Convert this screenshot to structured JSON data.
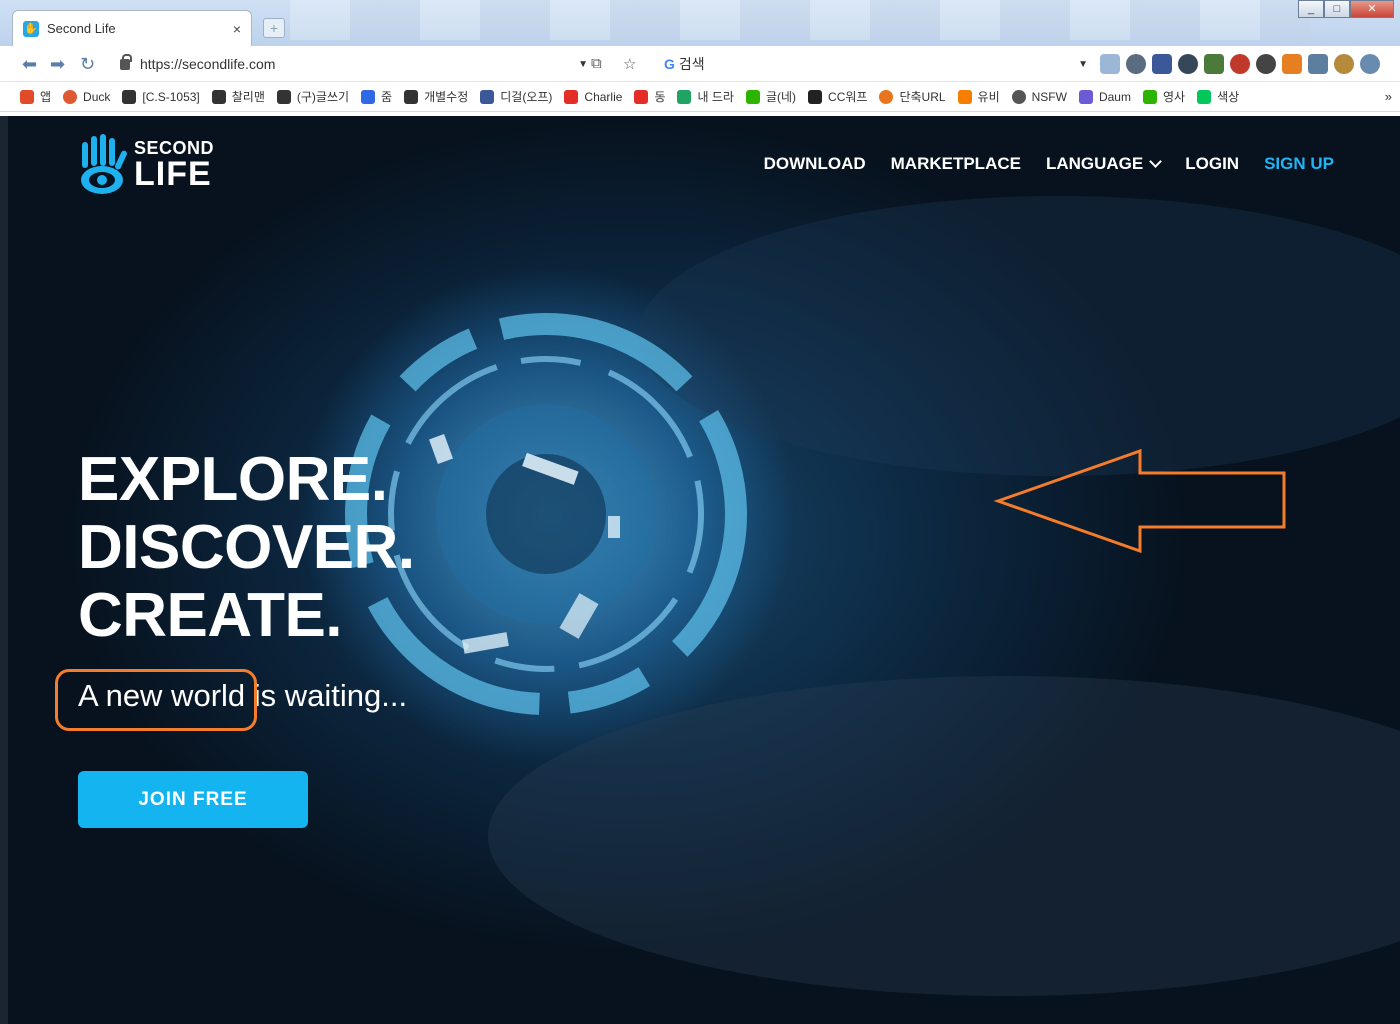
{
  "browser": {
    "tab_title": "Second Life",
    "tab_close": "×",
    "new_tab": "+",
    "url": "https://secondlife.com",
    "search_placeholder": "검색",
    "window_controls": [
      "_",
      "□",
      "✕"
    ]
  },
  "bookmarks": [
    {
      "label": "앱",
      "color": "#e04b2a"
    },
    {
      "label": "Duck",
      "color": "#de5833"
    },
    {
      "label": "[C.S-1053]",
      "color": "#333333"
    },
    {
      "label": "찰리맨",
      "color": "#333333"
    },
    {
      "label": "(구)글쓰기",
      "color": "#333333"
    },
    {
      "label": "줌",
      "color": "#2d6ae3"
    },
    {
      "label": "개별수정",
      "color": "#333333"
    },
    {
      "label": "디걸(오프)",
      "color": "#3b5998"
    },
    {
      "label": "Charlie",
      "color": "#e52d27"
    },
    {
      "label": "동",
      "color": "#e52d27"
    },
    {
      "label": "내 드라",
      "color": "#1fa463"
    },
    {
      "label": "글(네)",
      "color": "#2db400"
    },
    {
      "label": "CC워프",
      "color": "#222222"
    },
    {
      "label": "단축URL",
      "color": "#e8741c"
    },
    {
      "label": "유비",
      "color": "#f57d00"
    },
    {
      "label": "NSFW",
      "color": "#555555"
    },
    {
      "label": "Daum",
      "color": "#6b5cd6"
    },
    {
      "label": "영사",
      "color": "#2db400"
    },
    {
      "label": "색상",
      "color": "#03c75a"
    }
  ],
  "bookmarks_more": "»",
  "site": {
    "logo_line1": "SECOND",
    "logo_line2": "LIFE",
    "nav": {
      "download": "DOWNLOAD",
      "marketplace": "MARKETPLACE",
      "language": "LANGUAGE",
      "login": "LOGIN",
      "signup": "SIGN UP"
    },
    "headline": [
      "EXPLORE.",
      "DISCOVER.",
      "CREATE."
    ],
    "subline": "A new world is waiting...",
    "cta": "JOIN FREE",
    "accent_color": "#14b4f0",
    "annotation_color": "#f47c2a"
  }
}
